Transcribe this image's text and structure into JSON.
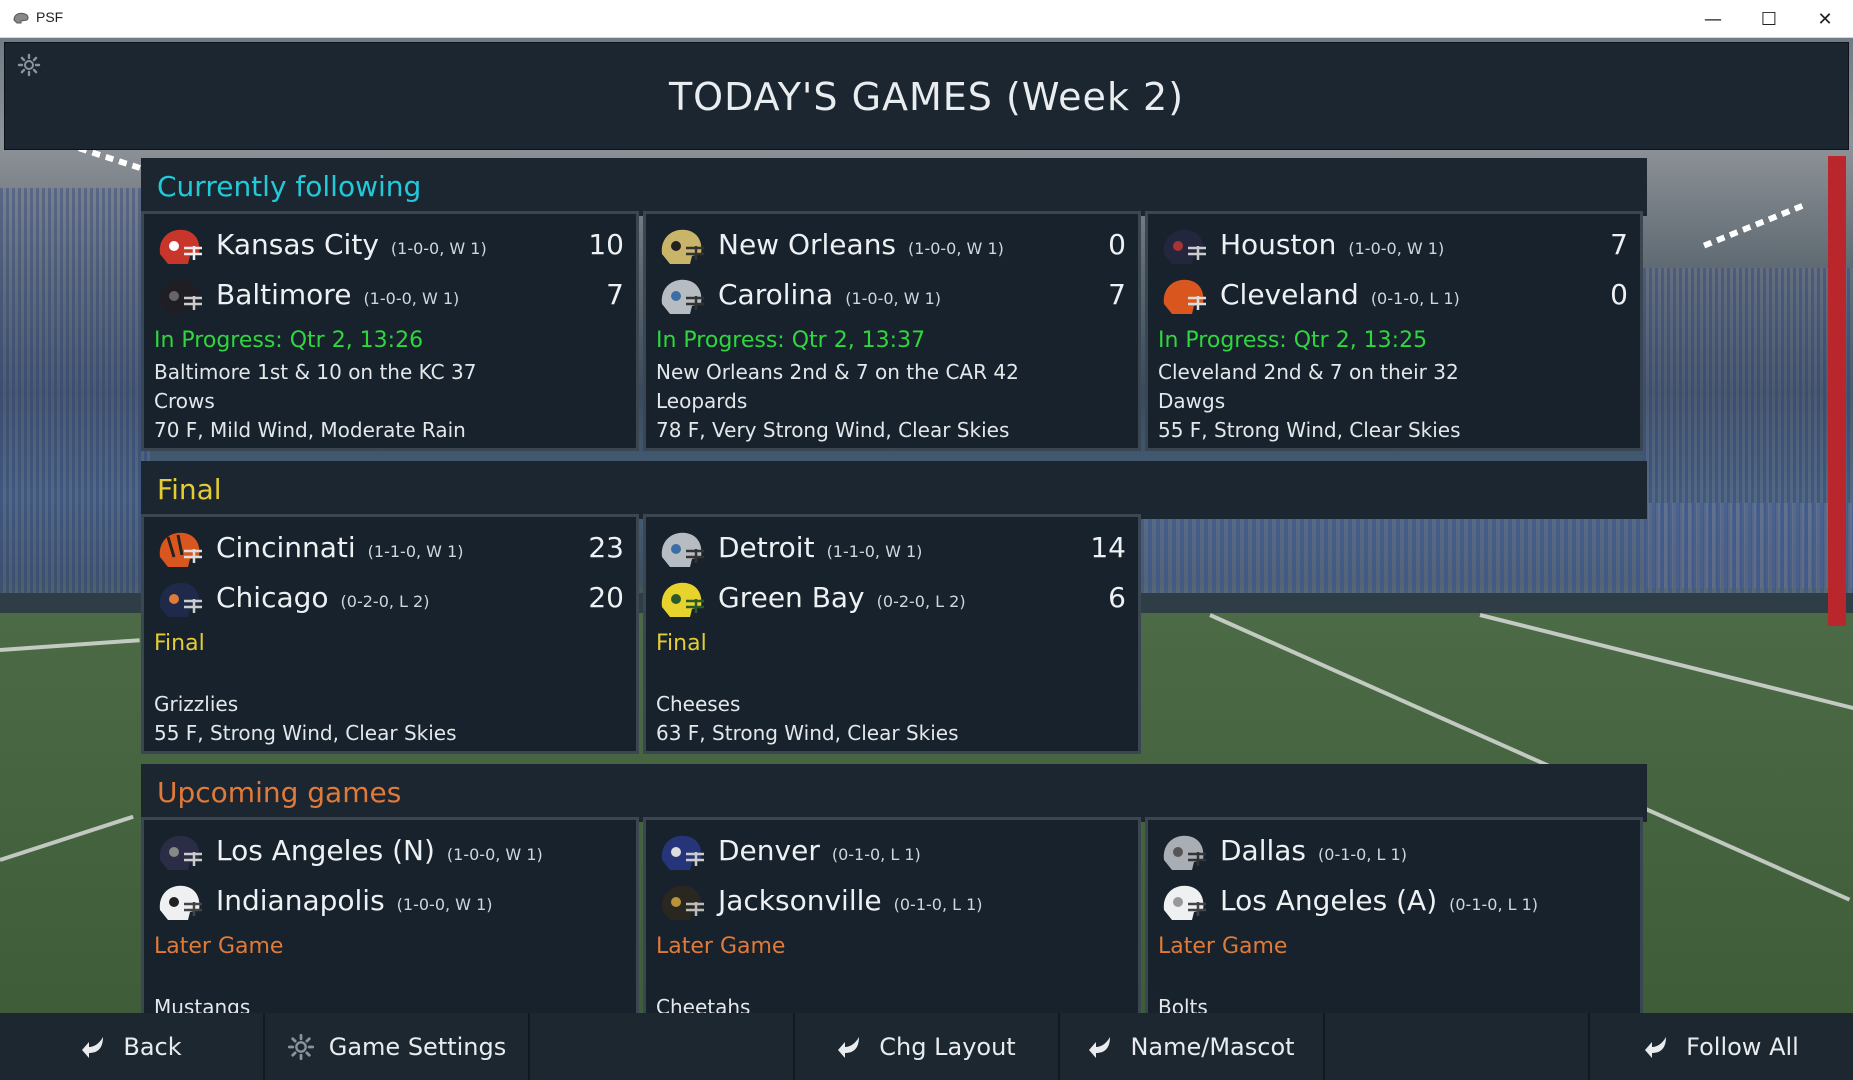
{
  "window": {
    "title": "PSF",
    "minimize": "—",
    "maximize": "☐",
    "close": "✕"
  },
  "header": {
    "title": "TODAY'S GAMES (Week 2)"
  },
  "sections": {
    "following": "Currently following",
    "final": "Final",
    "upcoming": "Upcoming games"
  },
  "following": [
    {
      "team1": {
        "name": "Kansas City",
        "record": "(1-0-0, W 1)",
        "score": "10",
        "helmet": "red"
      },
      "team2": {
        "name": "Baltimore",
        "record": "(1-0-0, W 1)",
        "score": "7",
        "helmet": "black"
      },
      "status": "In Progress: Qtr 2, 13:26",
      "situation": "Baltimore 1st & 10 on the KC 37",
      "mascot": "Crows",
      "weather": "70 F, Mild Wind, Moderate Rain"
    },
    {
      "team1": {
        "name": "New Orleans",
        "record": "(1-0-0, W 1)",
        "score": "0",
        "helmet": "gold"
      },
      "team2": {
        "name": "Carolina",
        "record": "(1-0-0, W 1)",
        "score": "7",
        "helmet": "silver"
      },
      "status": "In Progress: Qtr 2, 13:37",
      "situation": "New Orleans 2nd & 7 on the CAR 42",
      "mascot": "Leopards",
      "weather": "78 F, Very Strong Wind, Clear Skies"
    },
    {
      "team1": {
        "name": "Houston",
        "record": "(1-0-0, W 1)",
        "score": "7",
        "helmet": "navy"
      },
      "team2": {
        "name": "Cleveland",
        "record": "(0-1-0, L 1)",
        "score": "0",
        "helmet": "orange"
      },
      "status": "In Progress: Qtr 2, 13:25",
      "situation": "Cleveland 2nd & 7 on their 32",
      "mascot": "Dawgs",
      "weather": "55 F, Strong Wind, Clear Skies"
    }
  ],
  "final": [
    {
      "team1": {
        "name": "Cincinnati",
        "record": "(1-1-0, W 1)",
        "score": "23",
        "helmet": "orange"
      },
      "team2": {
        "name": "Chicago",
        "record": "(0-2-0, L 2)",
        "score": "20",
        "helmet": "navy"
      },
      "status": "Final",
      "mascot": "Grizzlies",
      "weather": "55 F, Strong Wind, Clear Skies"
    },
    {
      "team1": {
        "name": "Detroit",
        "record": "(1-1-0, W 1)",
        "score": "14",
        "helmet": "silver"
      },
      "team2": {
        "name": "Green Bay",
        "record": "(0-2-0, L 2)",
        "score": "6",
        "helmet": "yellow"
      },
      "status": "Final",
      "mascot": "Cheeses",
      "weather": "63 F, Strong Wind, Clear Skies"
    }
  ],
  "upcoming": [
    {
      "team1": {
        "name": "Los Angeles (N)",
        "record": "(1-0-0, W 1)",
        "helmet": "navy"
      },
      "team2": {
        "name": "Indianapolis",
        "record": "(1-0-0, W 1)",
        "helmet": "white"
      },
      "status": "Later Game",
      "mascot": "Mustangs"
    },
    {
      "team1": {
        "name": "Denver",
        "record": "(0-1-0, L 1)",
        "helmet": "blue"
      },
      "team2": {
        "name": "Jacksonville",
        "record": "(0-1-0, L 1)",
        "helmet": "black"
      },
      "status": "Later Game",
      "mascot": "Cheetahs"
    },
    {
      "team1": {
        "name": "Dallas",
        "record": "(0-1-0, L 1)",
        "helmet": "silver"
      },
      "team2": {
        "name": "Los Angeles (A)",
        "record": "(0-1-0, L 1)",
        "helmet": "white"
      },
      "status": "Later Game",
      "mascot": "Bolts"
    }
  ],
  "toolbar": {
    "back": "Back",
    "game_settings": "Game Settings",
    "chg_layout": "Chg Layout",
    "name_mascot": "Name/Mascot",
    "follow_all": "Follow All"
  },
  "colors": {
    "following": "#22c9d9",
    "final": "#e4cc33",
    "upcoming": "#e07a38",
    "in_progress": "#2fd63e"
  }
}
